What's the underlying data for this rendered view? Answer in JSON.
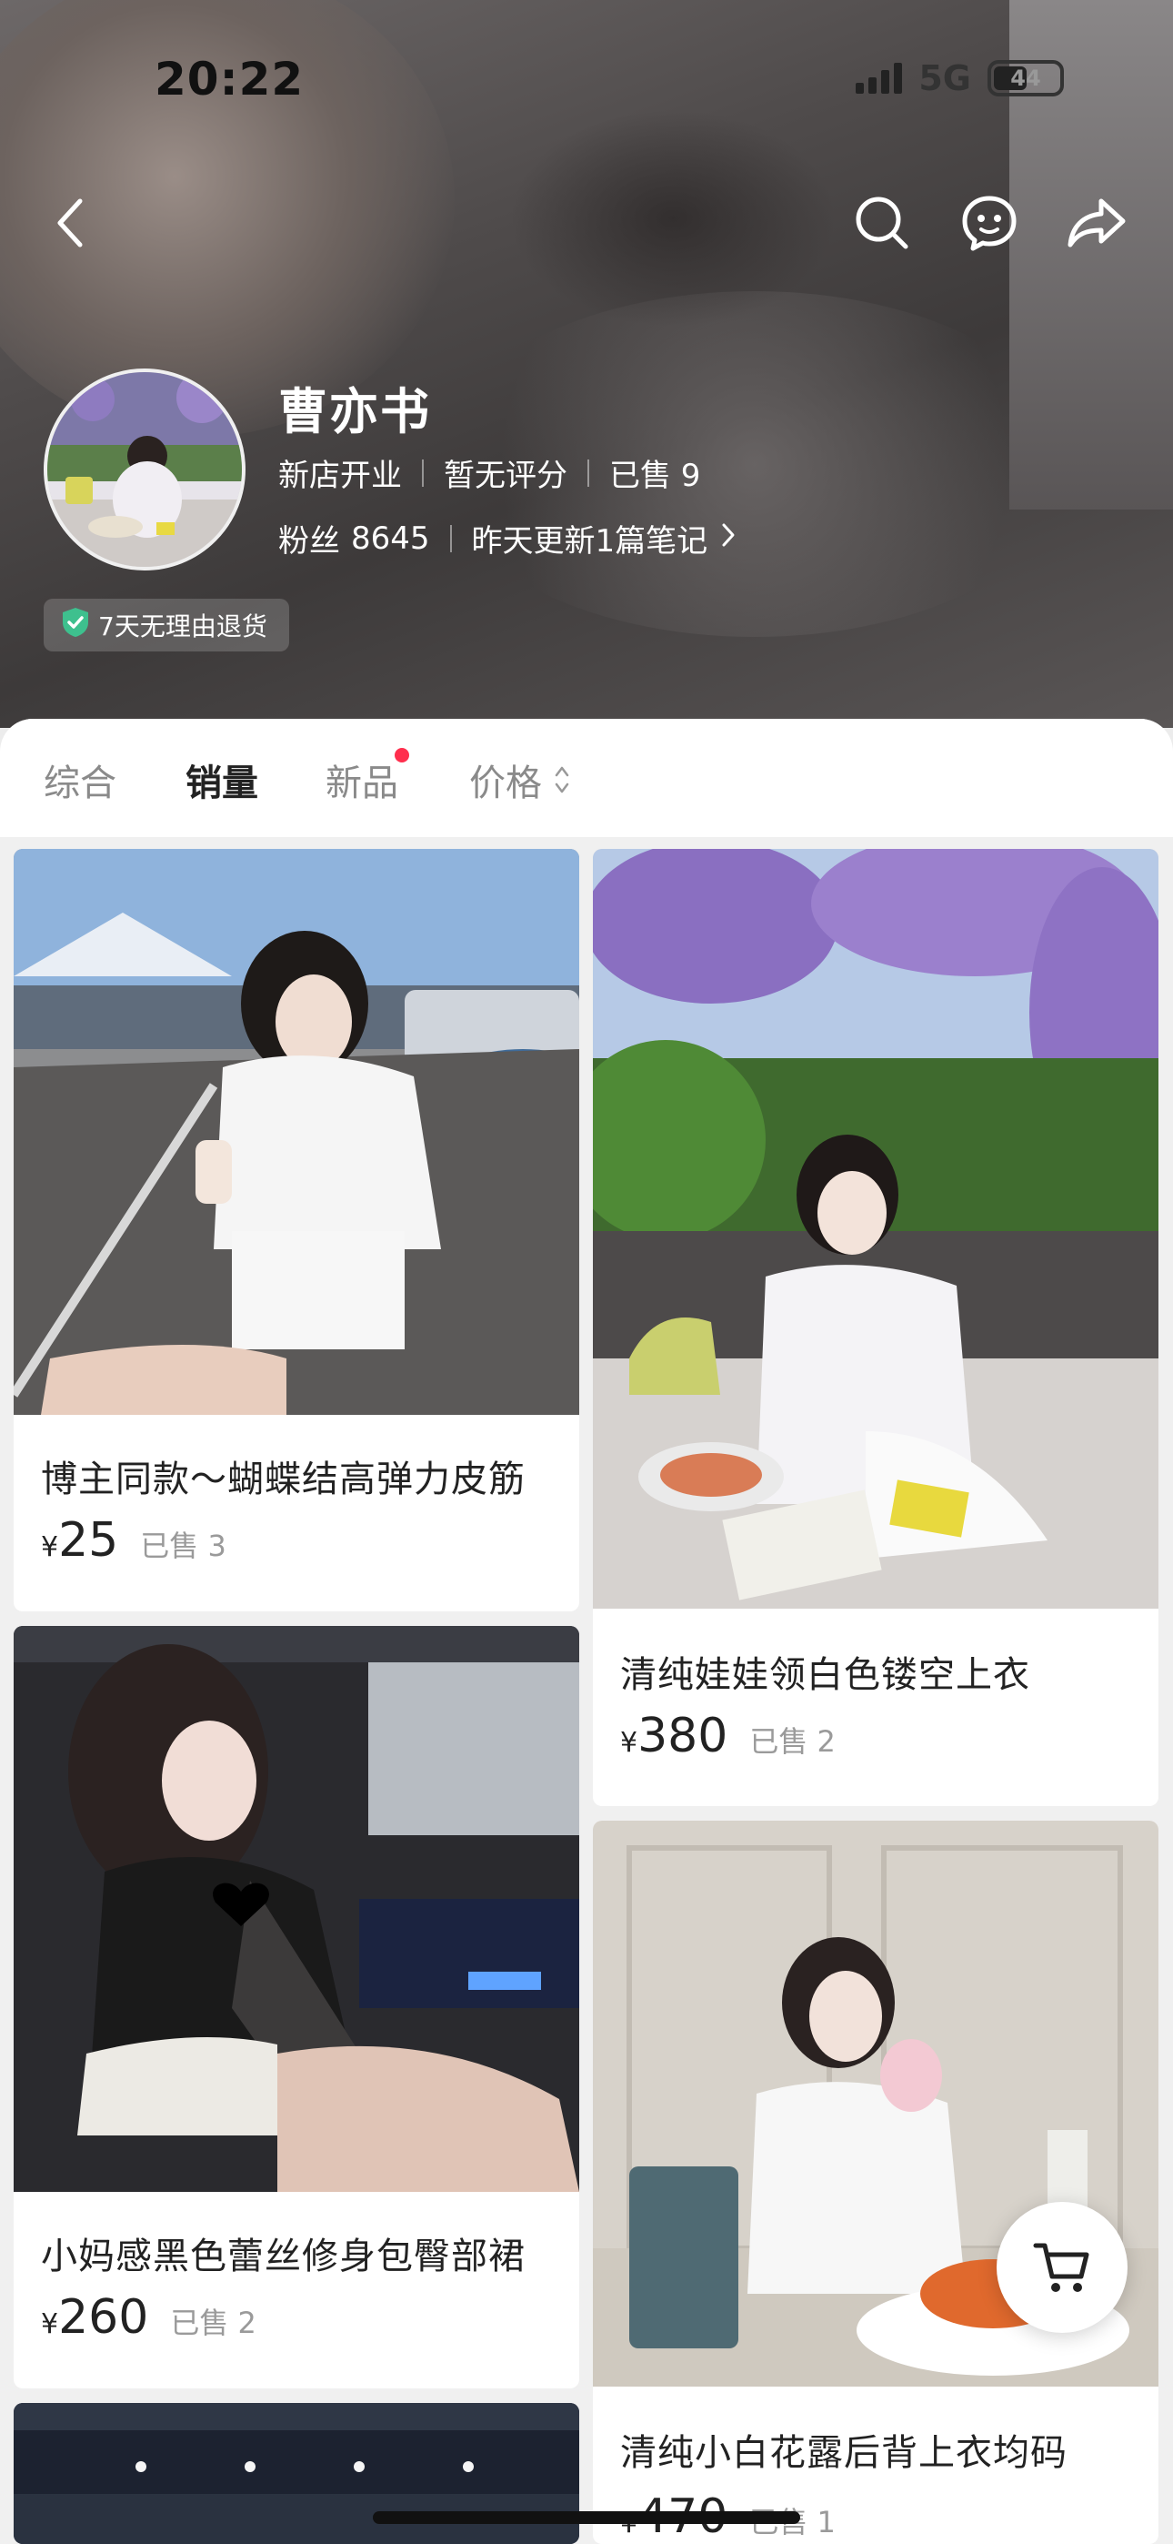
{
  "status_bar": {
    "time": "20:22",
    "network": "5G",
    "battery": "44"
  },
  "nav": {
    "back_icon": "back-arrow-icon",
    "search_icon": "search-icon",
    "message_icon": "chat-bubble-icon",
    "share_icon": "share-icon"
  },
  "shop": {
    "name": "曹亦书",
    "meta": [
      "新店开业",
      "暂无评分",
      "已售 9"
    ],
    "fans_label": "粉丝",
    "fans_count": "8645",
    "update_text": "昨天更新1篇笔记",
    "badge_text": "7天无理由退货"
  },
  "sort_tabs": [
    {
      "label": "综合",
      "active": false
    },
    {
      "label": "销量",
      "active": true
    },
    {
      "label": "新品",
      "active": false,
      "dot": true
    },
    {
      "label": "价格",
      "active": false,
      "icon": "sort-updown-icon"
    }
  ],
  "products": [
    {
      "title": "博主同款～蝴蝶结高弹力皮筋",
      "currency": "¥",
      "price": "25",
      "sold": "已售 3"
    },
    {
      "title": "清纯娃娃领白色镂空上衣",
      "currency": "¥",
      "price": "380",
      "sold": "已售 2"
    },
    {
      "title": "小妈感黑色蕾丝修身包臀部裙",
      "currency": "¥",
      "price": "260",
      "sold": "已售 2"
    },
    {
      "title": "清纯小白花露后背上衣均码",
      "currency": "¥",
      "price": "470",
      "sold": "已售 1"
    }
  ],
  "cart_icon": "shopping-cart-icon",
  "colors": {
    "accent_dot": "#ff2e4d",
    "badge_check": "#3ec08e"
  }
}
